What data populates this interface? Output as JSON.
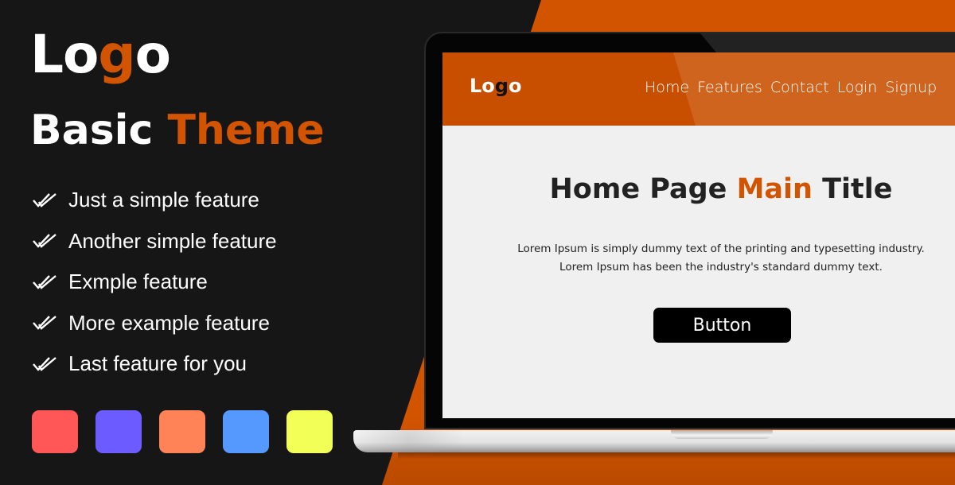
{
  "brand": {
    "logo_prefix": "Lo",
    "logo_accent": "g",
    "logo_suffix": "o",
    "title_plain": "Basic ",
    "title_accent": "Theme"
  },
  "features": [
    {
      "icon": "double-check-icon",
      "label": "Just a simple feature"
    },
    {
      "icon": "double-check-icon",
      "label": "Another simple feature"
    },
    {
      "icon": "double-check-icon",
      "label": "Exmple feature"
    },
    {
      "icon": "double-check-icon",
      "label": "More example feature"
    },
    {
      "icon": "double-check-icon",
      "label": "Last feature for you"
    }
  ],
  "palette": [
    "#ff5757",
    "#6c5cff",
    "#ff8356",
    "#5599ff",
    "#f2ff57"
  ],
  "colors": {
    "accent": "#d35400",
    "background": "#161616",
    "screen_background": "#f0f0f0"
  },
  "mockup": {
    "site_logo_prefix": "Lo",
    "site_logo_accent": "g",
    "site_logo_suffix": "o",
    "nav": [
      "Home",
      "Features",
      "Contact",
      "Login",
      "Signup"
    ],
    "hero_title_before": "Home Page ",
    "hero_title_accent": "Main",
    "hero_title_after": " Title",
    "hero_text_line1": "Lorem Ipsum is simply dummy text of the printing and typesetting industry.",
    "hero_text_line2": "Lorem Ipsum has been the industry's standard dummy text.",
    "button_label": "Button"
  }
}
